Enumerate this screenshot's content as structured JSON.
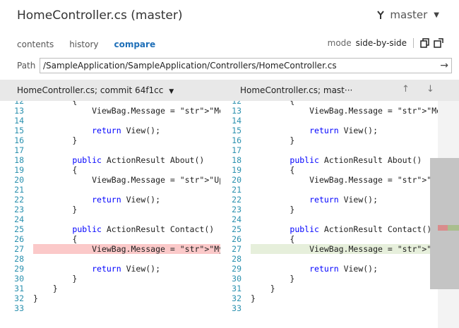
{
  "header": {
    "file_title": "HomeController.cs (master)",
    "branch_name": "master",
    "branch_icon": "branch-icon"
  },
  "tabs": [
    {
      "label": "contents",
      "active": false
    },
    {
      "label": "history",
      "active": false
    },
    {
      "label": "compare",
      "active": true
    }
  ],
  "mode": {
    "label": "mode",
    "value": "side-by-side"
  },
  "path": {
    "label": "Path",
    "value": "/SampleApplication/SampleApplication/Controllers/HomeController.cs"
  },
  "diff_header": {
    "left_title": "HomeController.cs; commit 64f1cc",
    "right_title": "HomeController.cs; mast···"
  },
  "colors": {
    "accent": "#1e6fb8",
    "removed_bg": "#fbc9c9",
    "added_bg": "#e6efdb",
    "line_number": "#2b91af"
  },
  "left_lines": [
    {
      "n": "12",
      "code": "        {",
      "state": ""
    },
    {
      "n": "13",
      "code": "            ViewBag.Message = \"Modify th",
      "state": ""
    },
    {
      "n": "14",
      "code": "",
      "state": ""
    },
    {
      "n": "15",
      "code": "            return View();",
      "state": ""
    },
    {
      "n": "16",
      "code": "        }",
      "state": ""
    },
    {
      "n": "17",
      "code": "",
      "state": ""
    },
    {
      "n": "18",
      "code": "        public ActionResult About()",
      "state": ""
    },
    {
      "n": "19",
      "code": "        {",
      "state": ""
    },
    {
      "n": "20",
      "code": "            ViewBag.Message = \"Updating t",
      "state": ""
    },
    {
      "n": "21",
      "code": "",
      "state": ""
    },
    {
      "n": "22",
      "code": "            return View();",
      "state": ""
    },
    {
      "n": "23",
      "code": "        }",
      "state": ""
    },
    {
      "n": "24",
      "code": "",
      "state": ""
    },
    {
      "n": "25",
      "code": "        public ActionResult Contact()",
      "state": ""
    },
    {
      "n": "26",
      "code": "        {",
      "state": ""
    },
    {
      "n": "27",
      "code": "            ViewBag.Message = \"My contact",
      "state": "removed"
    },
    {
      "n": "28",
      "code": "",
      "state": ""
    },
    {
      "n": "29",
      "code": "            return View();",
      "state": ""
    },
    {
      "n": "30",
      "code": "        }",
      "state": ""
    },
    {
      "n": "31",
      "code": "    }",
      "state": ""
    },
    {
      "n": "32",
      "code": "}",
      "state": ""
    },
    {
      "n": "33",
      "code": "",
      "state": ""
    }
  ],
  "right_lines": [
    {
      "n": "12",
      "code": "        {",
      "state": ""
    },
    {
      "n": "13",
      "code": "            ViewBag.Message = \"Modify th",
      "state": ""
    },
    {
      "n": "14",
      "code": "",
      "state": ""
    },
    {
      "n": "15",
      "code": "            return View();",
      "state": ""
    },
    {
      "n": "16",
      "code": "        }",
      "state": ""
    },
    {
      "n": "17",
      "code": "",
      "state": ""
    },
    {
      "n": "18",
      "code": "        public ActionResult About()",
      "state": ""
    },
    {
      "n": "19",
      "code": "        {",
      "state": ""
    },
    {
      "n": "20",
      "code": "            ViewBag.Message = \"Updating t",
      "state": ""
    },
    {
      "n": "21",
      "code": "",
      "state": ""
    },
    {
      "n": "22",
      "code": "            return View();",
      "state": ""
    },
    {
      "n": "23",
      "code": "        }",
      "state": ""
    },
    {
      "n": "24",
      "code": "",
      "state": ""
    },
    {
      "n": "25",
      "code": "        public ActionResult Contact()",
      "state": ""
    },
    {
      "n": "26",
      "code": "        {",
      "state": ""
    },
    {
      "n": "27",
      "code": "            ViewBag.Message = \"Updating ",
      "state": "added"
    },
    {
      "n": "28",
      "code": "",
      "state": ""
    },
    {
      "n": "29",
      "code": "            return View();",
      "state": ""
    },
    {
      "n": "30",
      "code": "        }",
      "state": ""
    },
    {
      "n": "31",
      "code": "    }",
      "state": ""
    },
    {
      "n": "32",
      "code": "}",
      "state": ""
    },
    {
      "n": "33",
      "code": "",
      "state": ""
    }
  ]
}
